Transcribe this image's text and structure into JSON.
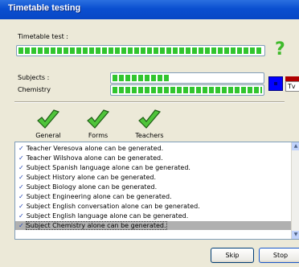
{
  "window": {
    "title": "Timetable testing"
  },
  "timetable_test": {
    "label": "Timetable test :",
    "progress": 1.0
  },
  "status_icon": "question-mark-icon",
  "subjects": {
    "label": "Subjects :",
    "progress": 0.38
  },
  "chemistry": {
    "label": "Chemistry",
    "progress": 1.0
  },
  "side_swatch": {
    "blue": "#0000ff",
    "red": "#b00000",
    "text": "Tv"
  },
  "nav": [
    {
      "label": "General",
      "icon": "green-check-icon"
    },
    {
      "label": "Forms",
      "icon": "green-check-icon"
    },
    {
      "label": "Teachers",
      "icon": "green-check-icon"
    }
  ],
  "log": {
    "items": [
      "Teacher Veresova alone can be generated.",
      "Teacher Wilshova alone can be generated.",
      "Subject Spanish language alone can be generated.",
      "Subject History alone can be generated.",
      "Subject Biology alone can be generated.",
      "Subject Engineering alone can be generated.",
      "Subject English conversation alone can be generated.",
      "Subject English language alone can be generated.",
      "Subject Chemistry alone can be generated."
    ],
    "selected_index": 8
  },
  "buttons": {
    "skip": "Skip",
    "stop": "Stop"
  },
  "colors": {
    "accent": "#0a4fd0",
    "progress": "#31c52e",
    "check": "#3fba2b"
  }
}
